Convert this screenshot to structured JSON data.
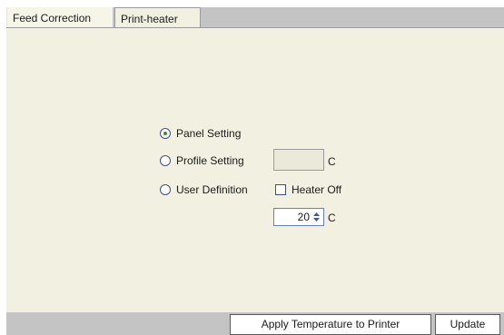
{
  "tabs": {
    "feed_correction": "Feed Correction",
    "print_heater": "Print-heater"
  },
  "options": {
    "panel_setting": "Panel Setting",
    "profile_setting": "Profile Setting",
    "user_definition": "User Definition",
    "selected": "panel_setting"
  },
  "profile": {
    "value": "",
    "unit": "C"
  },
  "heater_off": {
    "label": "Heater Off",
    "checked": false
  },
  "user_temp": {
    "value": "20",
    "unit": "C"
  },
  "buttons": {
    "apply": "Apply Temperature to Printer",
    "update": "Update"
  },
  "colors": {
    "panel_bg": "#f2f1e1",
    "bar_bg": "#c4c4c4",
    "radio_border": "#3b4f8c",
    "radio_dot": "#3d8a3d"
  },
  "icons": {
    "spin": "up-down-arrows-icon"
  }
}
